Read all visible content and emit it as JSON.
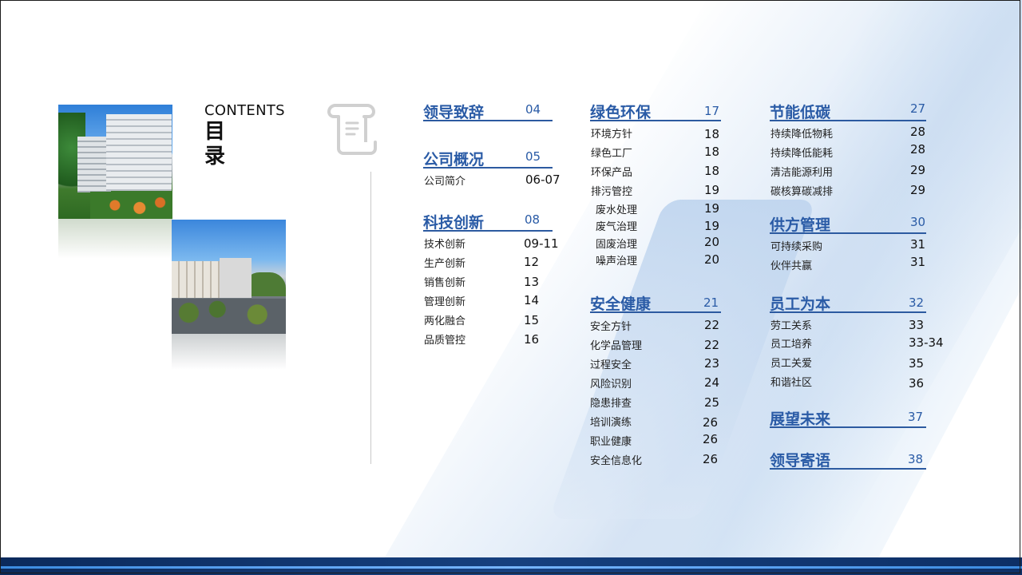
{
  "header": {
    "contents_en": "CONTENTS",
    "contents_cn": "目录"
  },
  "icons": {
    "scroll": "scroll-document-icon"
  },
  "colors": {
    "accent": "#2a5ba6",
    "bar_dark": "#0b2a5c",
    "bar_light": "#3b8be0"
  },
  "sections": {
    "lingdao": {
      "title": "领导致辞",
      "page": "04"
    },
    "gongsi": {
      "title": "公司概况",
      "page": "05",
      "items": [
        {
          "label": "公司简介",
          "page": "06-07"
        }
      ]
    },
    "keji": {
      "title": "科技创新",
      "page": "08",
      "items": [
        {
          "label": "技术创新",
          "page": "09-11"
        },
        {
          "label": "生产创新",
          "page": "12"
        },
        {
          "label": "销售创新",
          "page": "13"
        },
        {
          "label": "管理创新",
          "page": "14"
        },
        {
          "label": "两化融合",
          "page": "15"
        },
        {
          "label": "品质管控",
          "page": "16"
        }
      ]
    },
    "lvse": {
      "title": "绿色环保",
      "page": "17",
      "items": [
        {
          "label": "环境方针",
          "page": "18"
        },
        {
          "label": "绿色工厂",
          "page": "18"
        },
        {
          "label": "环保产品",
          "page": "18"
        },
        {
          "label": "排污管控",
          "page": "19"
        },
        {
          "label": "废水处理",
          "page": "19"
        },
        {
          "label": "废气治理",
          "page": "19"
        },
        {
          "label": "固废治理",
          "page": "20"
        },
        {
          "label": "噪声治理",
          "page": "20"
        }
      ]
    },
    "anquan": {
      "title": "安全健康",
      "page": "21",
      "items": [
        {
          "label": "安全方针",
          "page": "22"
        },
        {
          "label": "化学品管理",
          "page": "22"
        },
        {
          "label": "过程安全",
          "page": "23"
        },
        {
          "label": "风险识别",
          "page": "24"
        },
        {
          "label": "隐患排查",
          "page": "25"
        },
        {
          "label": "培训演练",
          "page": "26"
        },
        {
          "label": "职业健康",
          "page": "26"
        },
        {
          "label": "安全信息化",
          "page": "26"
        }
      ]
    },
    "jieneng": {
      "title": "节能低碳",
      "page": "27",
      "items": [
        {
          "label": "持续降低物耗",
          "page": "28"
        },
        {
          "label": "持续降低能耗",
          "page": "28"
        },
        {
          "label": "清洁能源利用",
          "page": "29"
        },
        {
          "label": "碳核算碳减排",
          "page": "29"
        }
      ]
    },
    "gongfang": {
      "title": "供方管理",
      "page": "30",
      "items": [
        {
          "label": "可持续采购",
          "page": "31"
        },
        {
          "label": "伙伴共赢",
          "page": "31"
        }
      ]
    },
    "yuangong": {
      "title": "员工为本",
      "page": "32",
      "items": [
        {
          "label": "劳工关系",
          "page": "33"
        },
        {
          "label": "员工培养",
          "page": "33-34"
        },
        {
          "label": "员工关爱",
          "page": "35"
        },
        {
          "label": "和谐社区",
          "page": "36"
        }
      ]
    },
    "zhanwang": {
      "title": "展望未来",
      "page": "37"
    },
    "jiyu": {
      "title": "领导寄语",
      "page": "38"
    }
  }
}
